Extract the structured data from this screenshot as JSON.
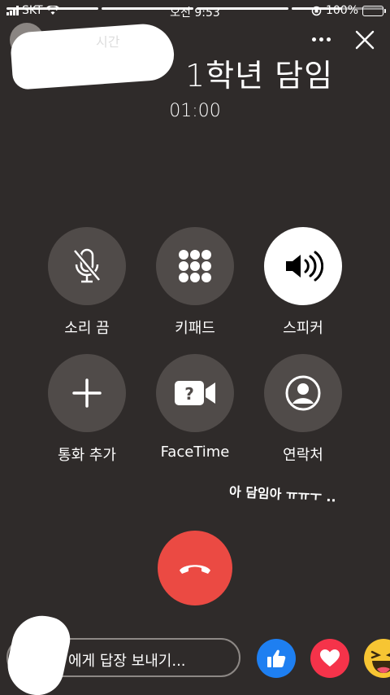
{
  "status_bar": {
    "carrier": "SKT",
    "time": "오전 9:53",
    "battery": "100%"
  },
  "story": {
    "progress": [
      1.0,
      1.0,
      1.0,
      0.55
    ],
    "time_ago": "시간"
  },
  "call": {
    "caller_name": "1학년 담임",
    "timer": "01:00"
  },
  "controls": [
    {
      "label": "소리 끔",
      "icon": "mic-off-icon",
      "active": false
    },
    {
      "label": "키패드",
      "icon": "keypad-icon",
      "active": false
    },
    {
      "label": "스피커",
      "icon": "speaker-icon",
      "active": true
    },
    {
      "label": "통화 추가",
      "icon": "plus-icon",
      "active": false
    },
    {
      "label": "FaceTime",
      "icon": "facetime-icon",
      "active": false
    },
    {
      "label": "연락처",
      "icon": "contacts-icon",
      "active": false
    }
  ],
  "annotation": "아 담임아 ㅠㅠㅜ ..",
  "reply": {
    "text": "에게 답장 보내기..."
  },
  "reactions": [
    "like-icon",
    "love-icon",
    "haha-icon"
  ],
  "colors": {
    "background": "#2f2b2a",
    "button": "#504b49",
    "end_call": "#eb4a43",
    "like": "#1e7ff1",
    "love": "#f5334a",
    "haha": "#f7c533"
  }
}
